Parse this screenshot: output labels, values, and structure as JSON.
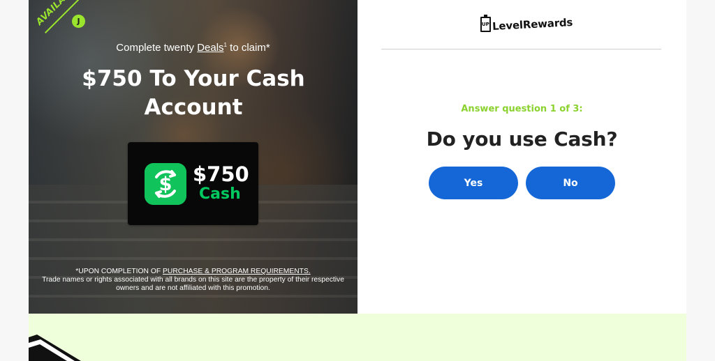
{
  "hero": {
    "badge_initial": "J",
    "available_label": "AVAILABLE!",
    "claim_prefix": "Complete twenty",
    "claim_link": "Deals",
    "claim_superscript": "1",
    "claim_suffix": "to claim*",
    "title": "$750 To Your Cash Account",
    "card_amount": "$750",
    "card_label": "Cash",
    "disclaimer_prefix": "*UPON COMPLETION OF",
    "disclaimer_link": "PURCHASE & PROGRAM REQUIREMENTS.",
    "disclaimer_body": "Trade names or rights associated with all brands on this site are the property of their respective owners and are not affiliated with this promotion."
  },
  "brand": {
    "mark_text": "UP",
    "name": "LevelRewards"
  },
  "question": {
    "kicker": "Answer question 1 of 3:",
    "title": "Do you use Cash?",
    "answers": [
      {
        "label": "Yes"
      },
      {
        "label": "No"
      }
    ]
  },
  "colors": {
    "accent_green": "#9ae42e",
    "button_blue": "#1567d8",
    "cash_green": "#11c35b",
    "bottom_band": "#efffdb"
  },
  "icons": {
    "cash_app": "cash-app-icon",
    "available_badge": "j-badge-icon",
    "brand_mark": "up-level-rewards-logo-icon"
  }
}
